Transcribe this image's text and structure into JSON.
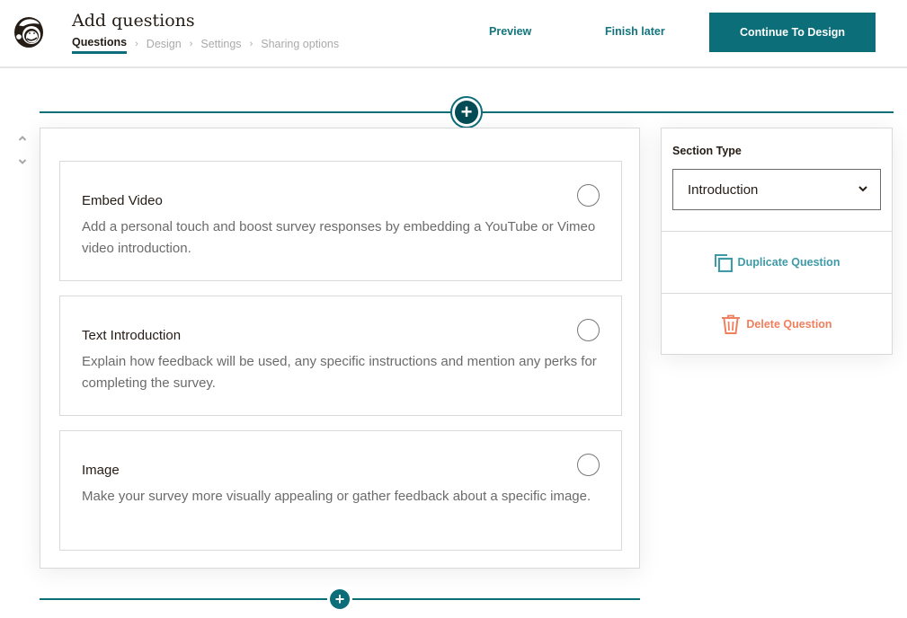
{
  "header": {
    "title": "Add questions",
    "steps": [
      {
        "label": "Questions",
        "active": true
      },
      {
        "label": "Design",
        "active": false
      },
      {
        "label": "Settings",
        "active": false
      },
      {
        "label": "Sharing options",
        "active": false
      }
    ],
    "step_separator": "›",
    "preview_label": "Preview",
    "finish_later_label": "Finish later",
    "continue_label": "Continue To Design",
    "logo_icon": "mailchimp-freddie-logo"
  },
  "controls": {
    "add_icon": "+",
    "move_up_icon": "⌃",
    "move_down_icon": "⌄"
  },
  "options": [
    {
      "title": "Embed Video",
      "description": "Add a personal touch and boost survey responses by embedding a YouTube or Vimeo video introduction.",
      "selected": false
    },
    {
      "title": "Text Introduction",
      "description": "Explain how feedback will be used, any specific instructions and mention any perks for completing the survey.",
      "selected": false
    },
    {
      "title": "Image",
      "description": "Make your survey more visually appealing or gather feedback about a specific image.",
      "selected": false
    }
  ],
  "side_panel": {
    "section_type_label": "Section Type",
    "section_type_value": "Introduction",
    "duplicate_label": "Duplicate Question",
    "delete_label": "Delete Question"
  },
  "colors": {
    "brand": "#0b6e78",
    "brand_dark": "#044c55",
    "duplicate": "#3e9aa6",
    "delete": "#ef7f5d"
  }
}
